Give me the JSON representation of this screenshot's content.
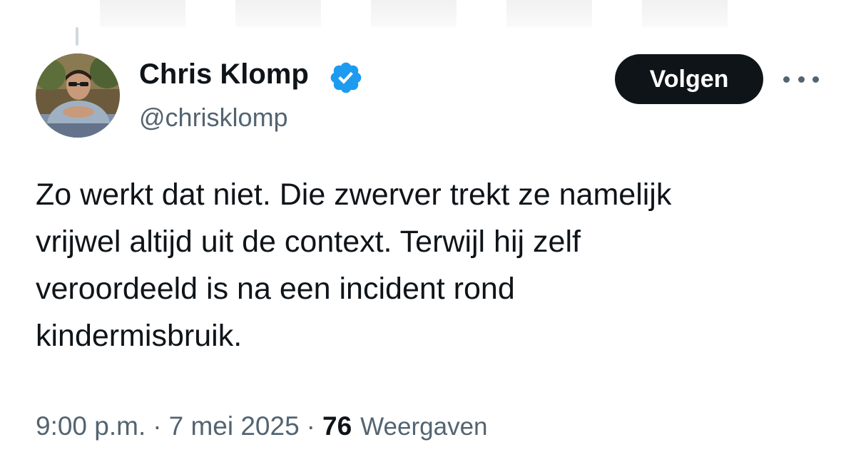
{
  "author": {
    "display_name": "Chris Klomp",
    "handle": "@chrisklomp",
    "verified": true,
    "verified_icon": "verified-badge-icon"
  },
  "actions": {
    "follow_label": "Volgen",
    "more_icon": "more-options-icon"
  },
  "tweet": {
    "lines": [
      "Zo werkt dat niet. Die zwerver trekt ze namelijk",
      "vrijwel altijd uit de context. Terwijl hij zelf",
      "veroordeeld is na een incident rond",
      "kindermisbruik."
    ]
  },
  "meta": {
    "time": "9:00 p.m.",
    "separator": "·",
    "date": "7 mei 2025",
    "views_count": "76",
    "views_label": "Weergaven"
  },
  "colors": {
    "text_primary": "#0f1419",
    "text_secondary": "#536471",
    "verified_blue": "#1d9bf0",
    "button_bg": "#0f1419"
  }
}
